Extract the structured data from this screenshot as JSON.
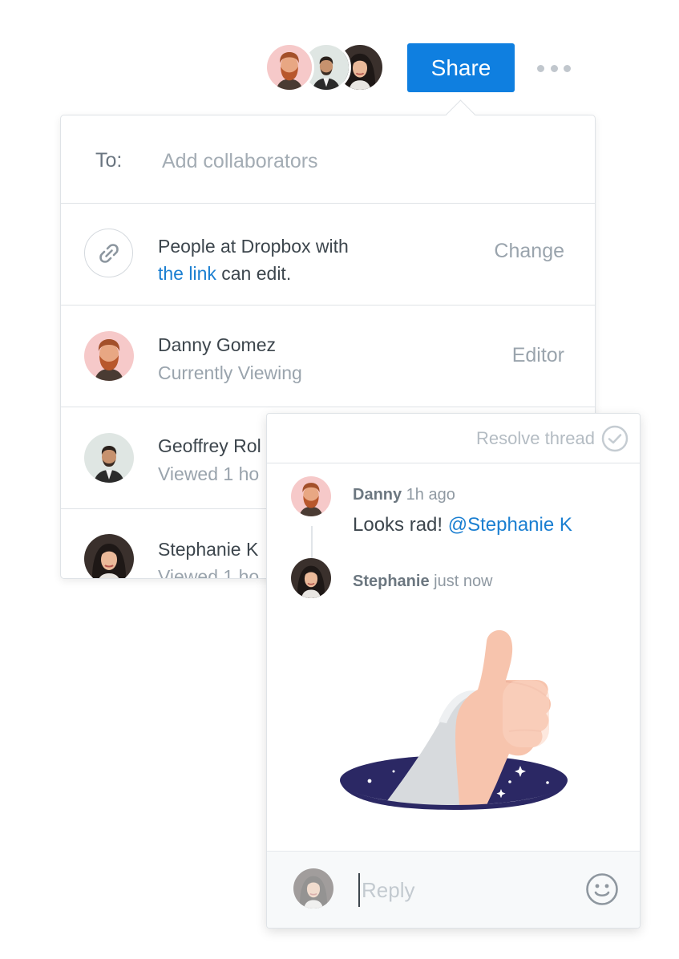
{
  "header": {
    "share_label": "Share",
    "more_icon": "more-horizontal-icon",
    "collaborator_avatars": [
      "danny-avatar",
      "geoffrey-avatar",
      "stephanie-avatar"
    ]
  },
  "share_panel": {
    "to_label": "To:",
    "to_placeholder": "Add collaborators",
    "link": {
      "icon": "link-icon",
      "text_before": "People at Dropbox with",
      "link_text": "the link",
      "text_after": " can edit.",
      "action": "Change"
    },
    "people": [
      {
        "name": "Danny Gomez",
        "status": "Currently Viewing",
        "role": "Editor"
      },
      {
        "name": "Geoffrey Rol",
        "status": "Viewed 1 ho"
      },
      {
        "name": "Stephanie K",
        "status": "Viewed 1 ho"
      }
    ]
  },
  "comment_panel": {
    "resolve_label": "Resolve thread",
    "comments": [
      {
        "author": "Danny",
        "time": " 1h ago",
        "text": "Looks rad! ",
        "mention": "@Stephanie K"
      },
      {
        "author": "Stephanie",
        "time": " just now",
        "attachment": "thumbs-up-illustration"
      }
    ],
    "reply_placeholder": "Reply",
    "emoji_icon": "smiley-icon"
  },
  "colors": {
    "accent": "#0f7fe0",
    "link": "#1b7fd1",
    "muted_text": "#9aa4ad",
    "border": "#dfe3e7",
    "hole": "#2b2864",
    "hand": "#f7c4ad",
    "sleeve": "#d7dadd"
  }
}
